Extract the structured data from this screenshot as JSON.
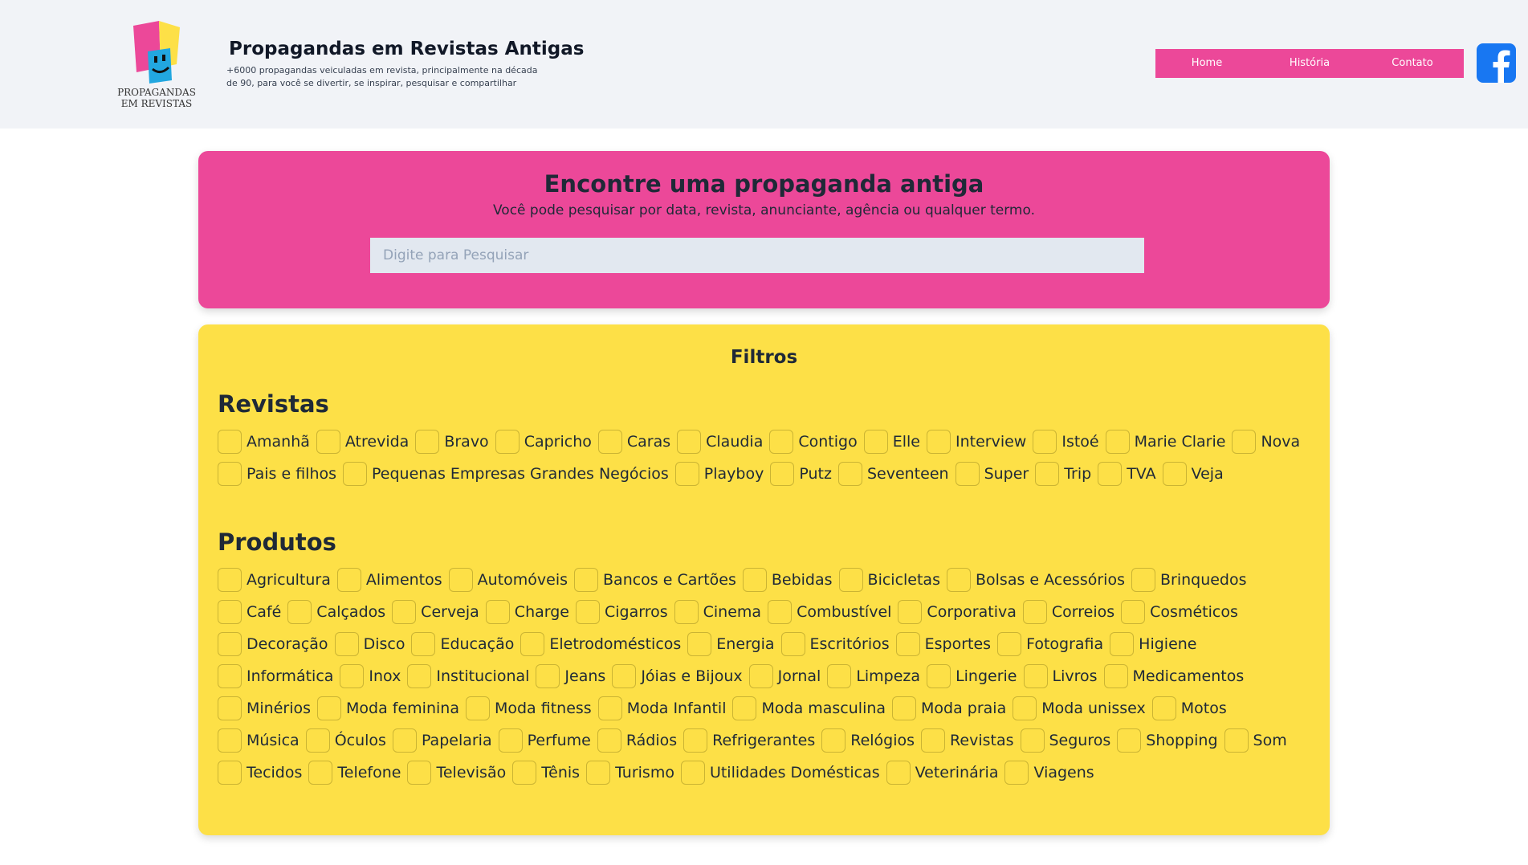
{
  "header": {
    "logo_text_line1": "PROPAGANDAS",
    "logo_text_line2": "EM REVISTAS",
    "title": "Propagandas em Revistas Antigas",
    "description": "+6000 propagandas veiculadas em revista, principalmente na década de 90, para você se divertir, se inspirar, pesquisar e compartilhar",
    "nav": [
      {
        "label": "Home"
      },
      {
        "label": "História"
      },
      {
        "label": "Contato"
      }
    ]
  },
  "search": {
    "title": "Encontre uma propaganda antiga",
    "subtitle": "Você pode pesquisar por data, revista, anunciante, agência ou qualquer termo.",
    "placeholder": "Digite para Pesquisar",
    "value": ""
  },
  "filters": {
    "title": "Filtros",
    "revistas_title": "Revistas",
    "revistas": [
      "Amanhã",
      "Atrevida",
      "Bravo",
      "Capricho",
      "Caras",
      "Claudia",
      "Contigo",
      "Elle",
      "Interview",
      "Istoé",
      "Marie Clarie",
      "Nova",
      "Pais e filhos",
      "Pequenas Empresas Grandes Negócios",
      "Playboy",
      "Putz",
      "Seventeen",
      "Super",
      "Trip",
      "TVA",
      "Veja"
    ],
    "produtos_title": "Produtos",
    "produtos": [
      "Agricultura",
      "Alimentos",
      "Automóveis",
      "Bancos e Cartões",
      "Bebidas",
      "Bicicletas",
      "Bolsas e Acessórios",
      "Brinquedos",
      "Café",
      "Calçados",
      "Cerveja",
      "Charge",
      "Cigarros",
      "Cinema",
      "Combustível",
      "Corporativa",
      "Correios",
      "Cosméticos",
      "Decoração",
      "Disco",
      "Educação",
      "Eletrodomésticos",
      "Energia",
      "Escritórios",
      "Esportes",
      "Fotografia",
      "Higiene",
      "Informática",
      "Inox",
      "Institucional",
      "Jeans",
      "Jóias e Bijoux",
      "Jornal",
      "Limpeza",
      "Lingerie",
      "Livros",
      "Medicamentos",
      "Minérios",
      "Moda feminina",
      "Moda fitness",
      "Moda Infantil",
      "Moda masculina",
      "Moda praia",
      "Moda unissex",
      "Motos",
      "Música",
      "Óculos",
      "Papelaria",
      "Perfume",
      "Rádios",
      "Refrigerantes",
      "Relógios",
      "Revistas",
      "Seguros",
      "Shopping",
      "Som",
      "Tecidos",
      "Telefone",
      "Televisão",
      "Tênis",
      "Turismo",
      "Utilidades Domésticas",
      "Veterinária",
      "Viagens"
    ]
  },
  "colors": {
    "accent_pink": "#ec4899",
    "filters_yellow": "#fde047",
    "header_bg": "#f1f3f7",
    "facebook_blue": "#1877f2"
  }
}
